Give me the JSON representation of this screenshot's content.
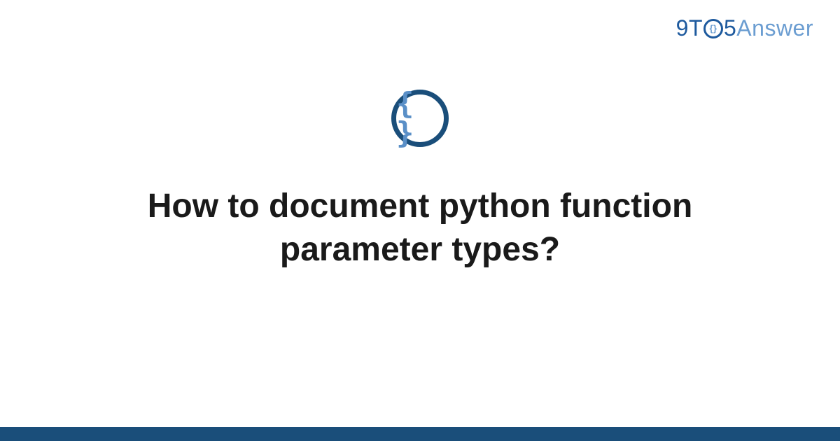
{
  "logo": {
    "part1": "9T",
    "part_o_inner": "{}",
    "part2": "5",
    "part3": "Answer"
  },
  "icon": {
    "braces": "{ }"
  },
  "title": "How to document python function parameter types?",
  "colors": {
    "brand_dark": "#1a4e7a",
    "brand_blue": "#1e5a9e",
    "brand_light": "#6b9dd1"
  }
}
